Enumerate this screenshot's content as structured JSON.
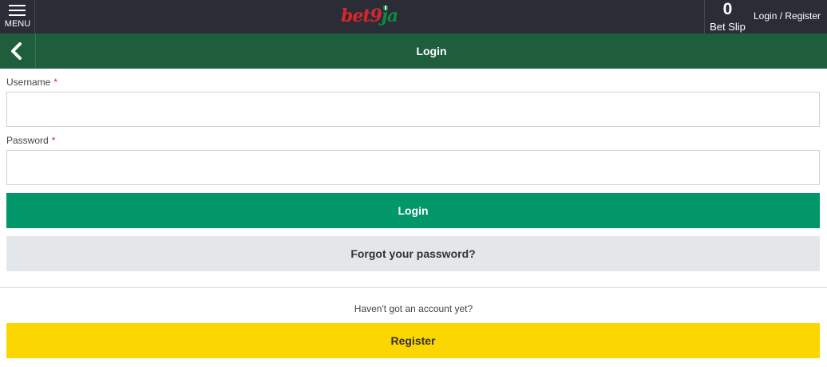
{
  "header": {
    "menu_label": "MENU",
    "logo": {
      "text_bet": "bet",
      "text_9": "9",
      "text_ja": "ja"
    },
    "bet_slip": {
      "count": "0",
      "label": "Bet Slip"
    },
    "auth_link": "Login / Register"
  },
  "titlebar": {
    "title": "Login"
  },
  "form": {
    "username": {
      "label": "Username",
      "required_mark": "*",
      "value": "",
      "placeholder": ""
    },
    "password": {
      "label": "Password",
      "required_mark": "*",
      "value": "",
      "placeholder": ""
    },
    "login_button": "Login",
    "forgot_button": "Forgot your password?"
  },
  "signup": {
    "prompt": "Haven't got an account yet?",
    "register_button": "Register"
  },
  "colors": {
    "topbar": "#2a2d35",
    "titlebar": "#1e5e3c",
    "login_button": "#029769",
    "forgot_button": "#e4e7ea",
    "register_button": "#fcd601",
    "required": "#d8262e"
  }
}
